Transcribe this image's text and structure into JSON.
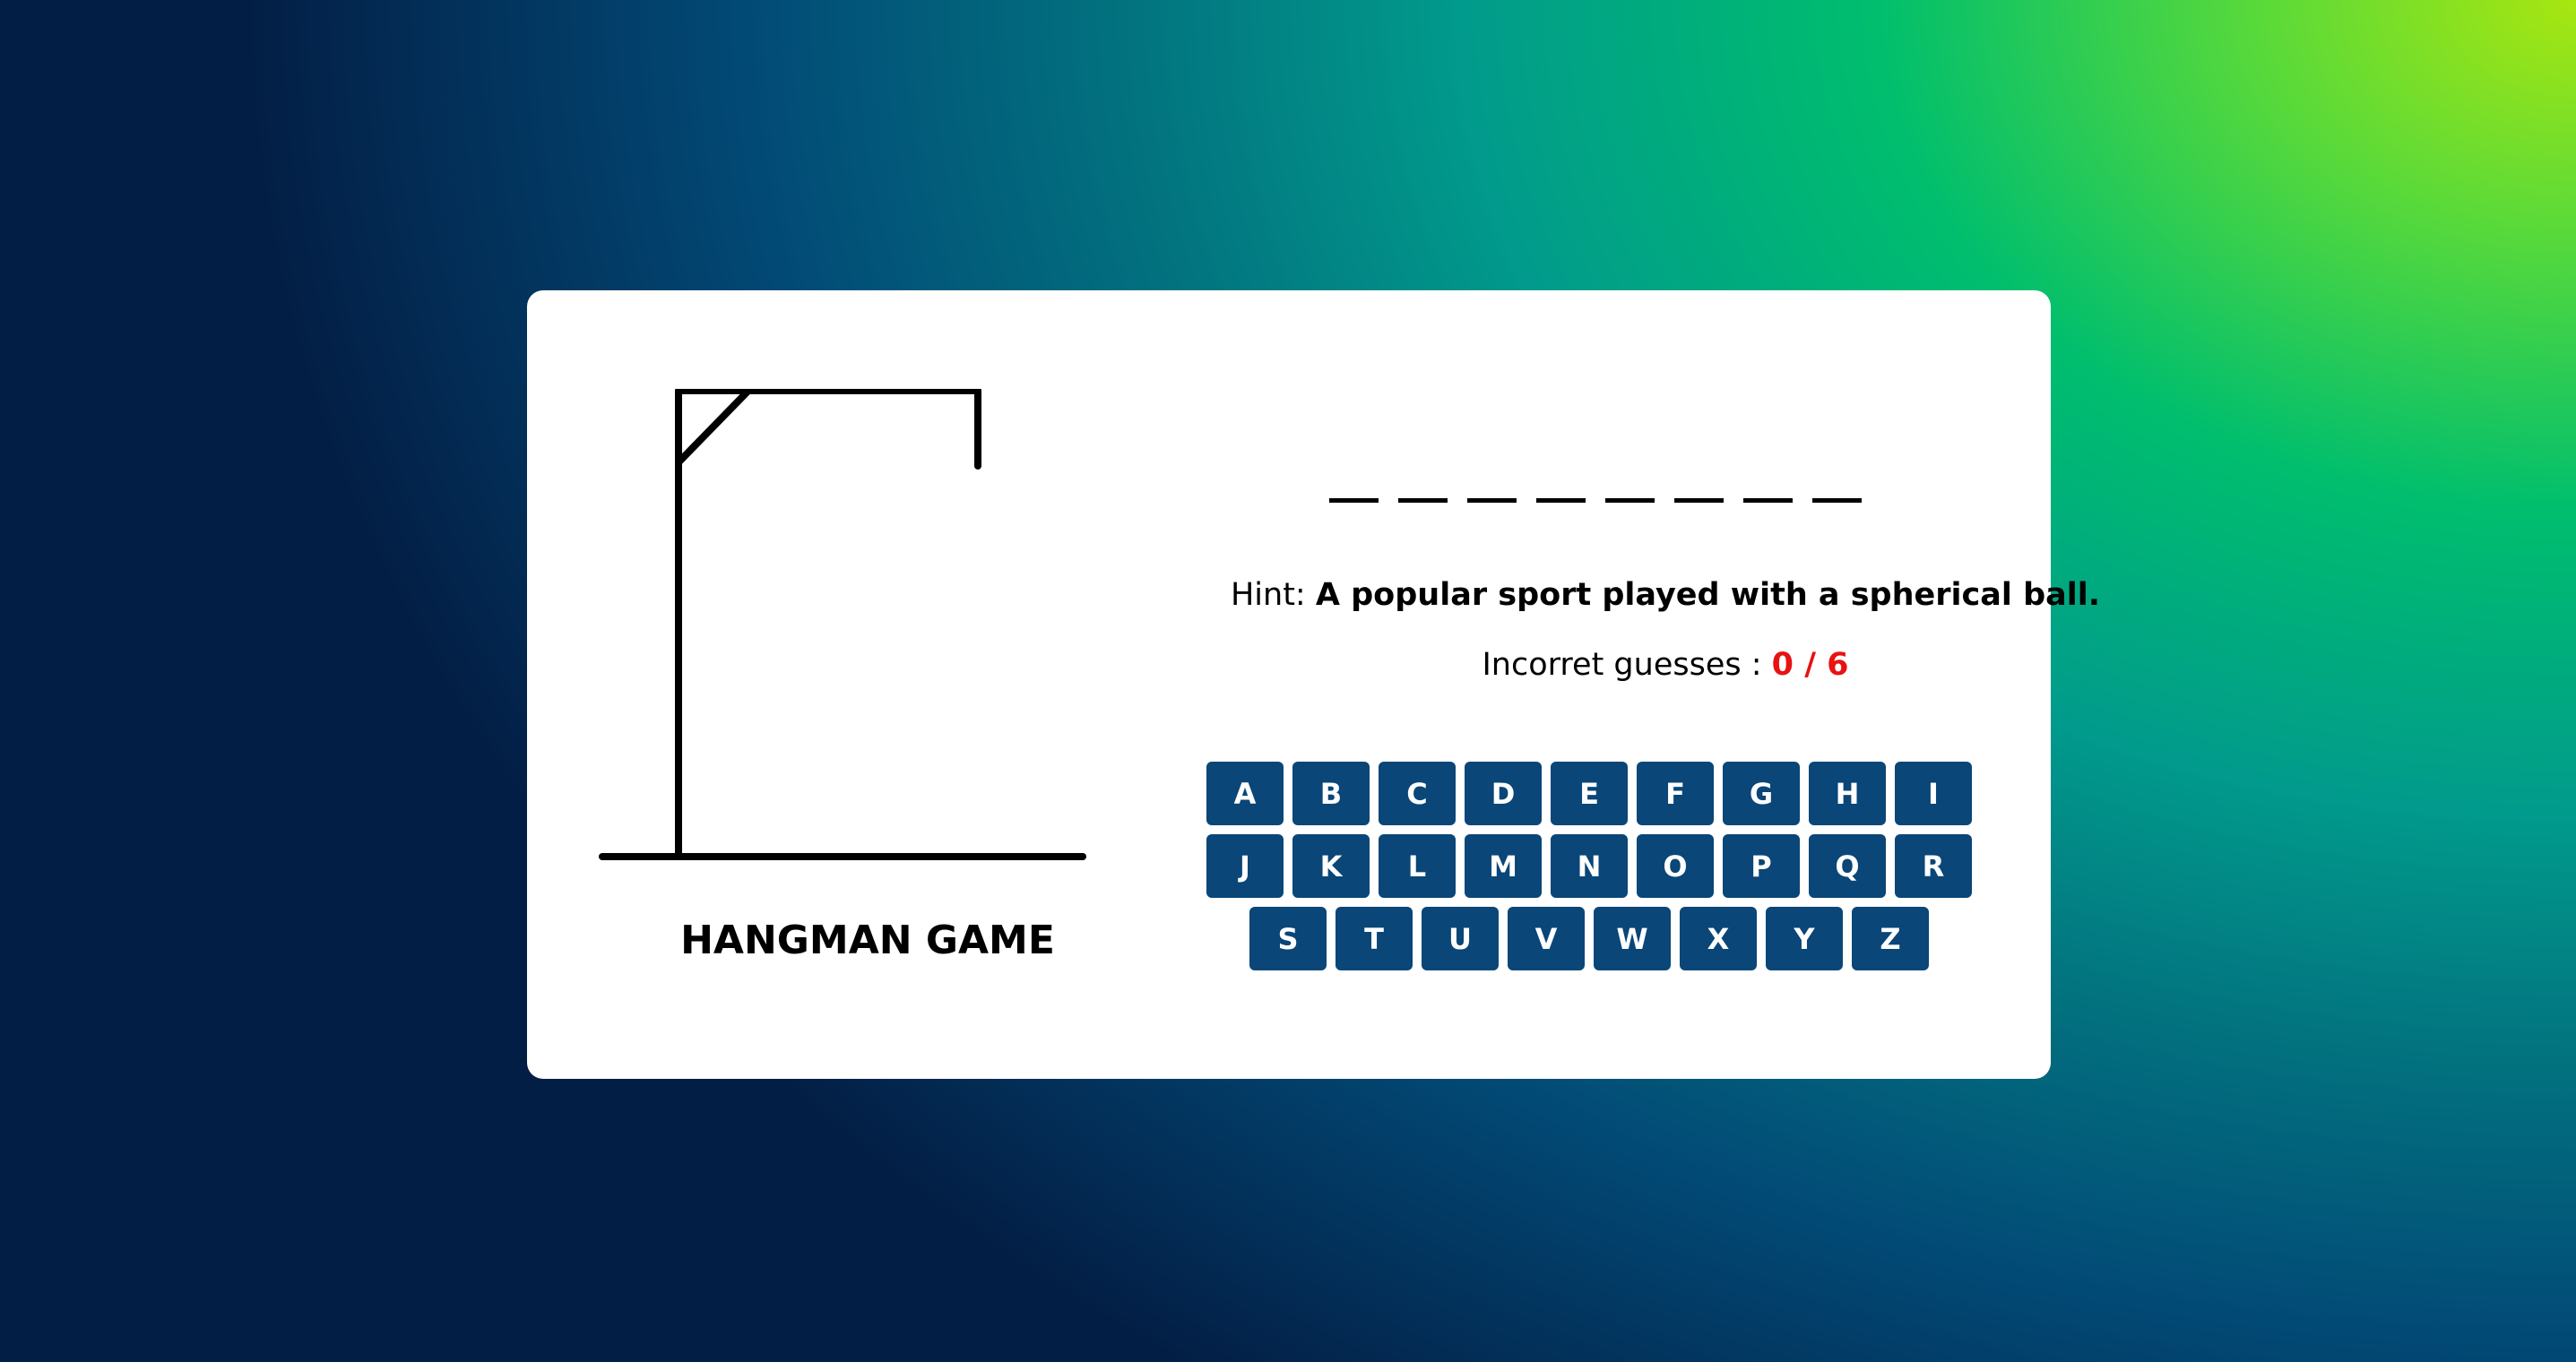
{
  "game": {
    "title": "HANGMAN GAME",
    "word_length": 8,
    "hint_label": "Hint:",
    "hint_text": "A popular sport played with a spherical ball.",
    "guesses_label": "Incorret guesses :",
    "incorrect_count": "0 / 6"
  },
  "keyboard": {
    "rows": [
      [
        "A",
        "B",
        "C",
        "D",
        "E",
        "F",
        "G",
        "H",
        "I"
      ],
      [
        "J",
        "K",
        "L",
        "M",
        "N",
        "O",
        "P",
        "Q",
        "R"
      ],
      [
        "S",
        "T",
        "U",
        "V",
        "W",
        "X",
        "Y",
        "Z"
      ]
    ]
  },
  "colors": {
    "key_background": "#0a4677",
    "key_text": "#ffffff",
    "incorrect_count": "#e81212",
    "card_background": "#ffffff"
  },
  "icons": {
    "hangman_drawing": "gallows-icon"
  }
}
